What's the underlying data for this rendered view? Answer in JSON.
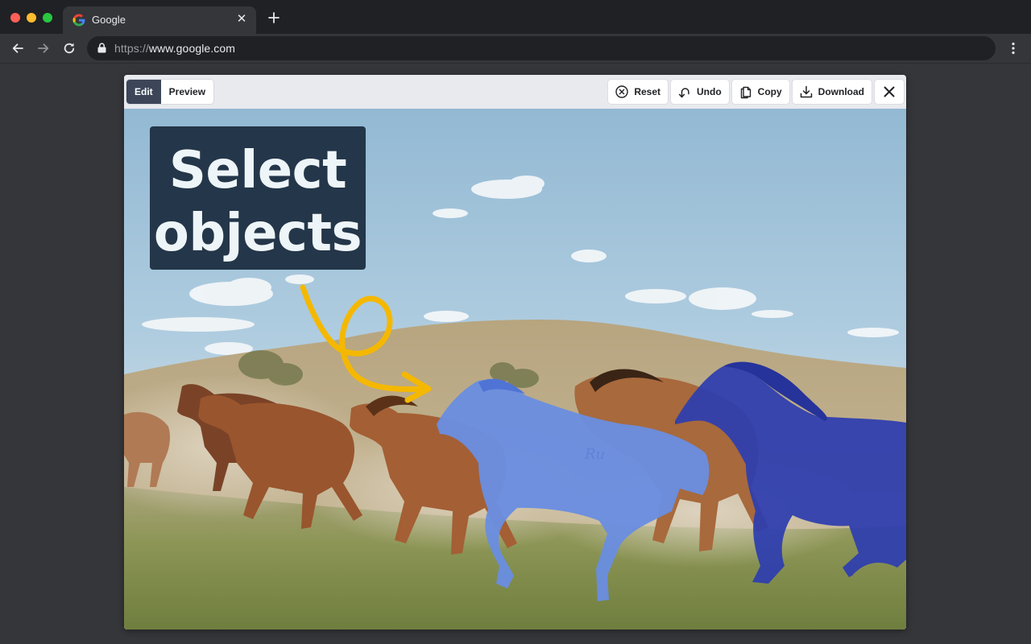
{
  "browser": {
    "tab_title": "Google",
    "url_scheme": "https://",
    "url_host": "www.google.com"
  },
  "editor": {
    "modes": [
      {
        "label": "Edit",
        "active": true
      },
      {
        "label": "Preview",
        "active": false
      }
    ],
    "actions": {
      "reset": "Reset",
      "undo": "Undo",
      "copy": "Copy",
      "download": "Download"
    },
    "callout": {
      "line1": "Select",
      "line2": "objects"
    },
    "colors": {
      "selection_light": "#6a8ee0",
      "selection_dark": "#2f3fae",
      "arrow": "#f5b800",
      "callout_bg": "#243649"
    }
  }
}
